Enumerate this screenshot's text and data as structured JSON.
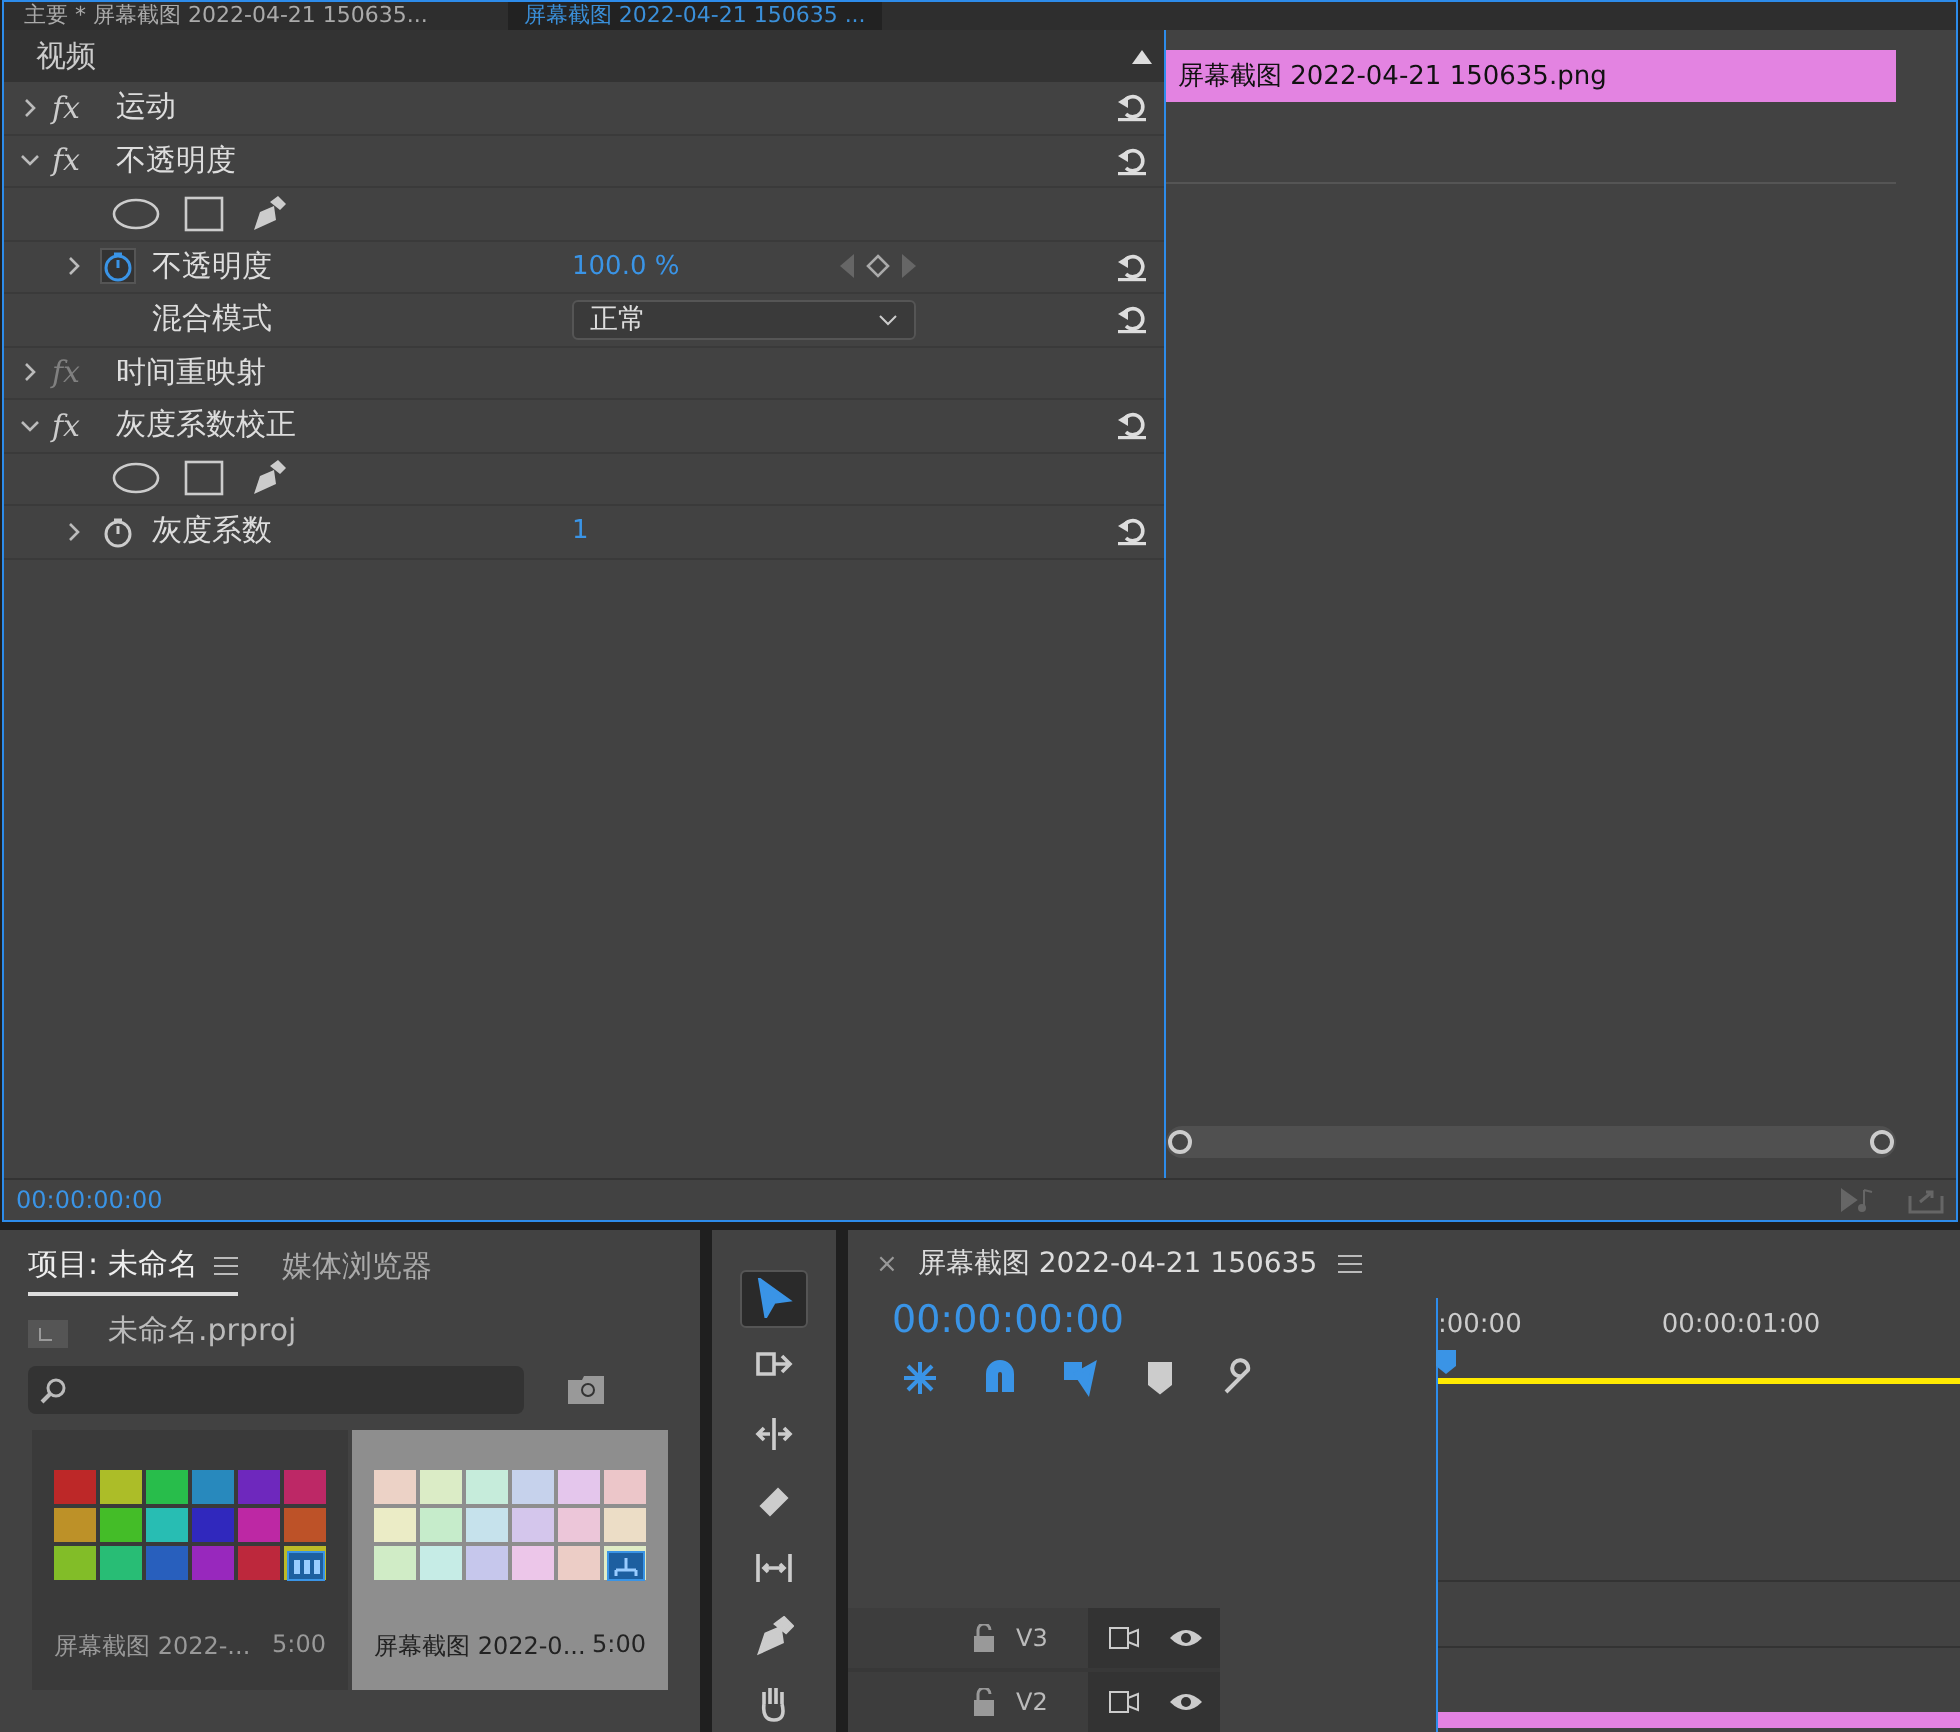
{
  "effect_controls": {
    "header": {
      "master": "主要 * 屏幕截图 2022-04-21 150635...",
      "clip": "屏幕截图 2022-04-21 150635 ..."
    },
    "section": "视频",
    "effects": [
      {
        "fx": "fx",
        "name": "运动",
        "expanded": false,
        "enabled": true,
        "resettable": true
      },
      {
        "fx": "fx",
        "name": "不透明度",
        "expanded": true,
        "enabled": true,
        "resettable": true,
        "params": [
          {
            "kind": "masks"
          },
          {
            "kind": "value",
            "name": "不透明度",
            "value": "100.0 %",
            "animated": true
          },
          {
            "kind": "dropdown",
            "name": "混合模式",
            "value": "正常"
          }
        ]
      },
      {
        "fx": "fx",
        "name": "时间重映射",
        "expanded": false,
        "enabled": false,
        "resettable": false
      },
      {
        "fx": "fx",
        "name": "灰度系数校正",
        "expanded": true,
        "enabled": true,
        "resettable": true,
        "params": [
          {
            "kind": "masks"
          },
          {
            "kind": "value",
            "name": "灰度系数",
            "value": "1",
            "animated": false
          }
        ]
      }
    ],
    "clip": {
      "label": "屏幕截图 2022-04-21  150635.png",
      "color": "#e383e1"
    },
    "timecode": "00:00:00:00"
  },
  "project": {
    "tabs": [
      {
        "label": "项目: 未命名",
        "selected": true
      },
      {
        "label": "媒体浏览器",
        "selected": false
      }
    ],
    "file": "未命名.prproj",
    "items": [
      {
        "kind": "clip",
        "name": "屏幕截图 2022-...",
        "duration": "5:00",
        "selected": false
      },
      {
        "kind": "sequence",
        "name": "屏幕截图 2022-0...",
        "duration": "5:00",
        "selected": true
      }
    ]
  },
  "tools": [
    {
      "selected": true
    },
    {
      "selected": false
    },
    {
      "selected": false
    },
    {
      "selected": false
    },
    {
      "selected": false
    },
    {
      "selected": false
    },
    {
      "selected": false
    }
  ],
  "timeline": {
    "close": "×",
    "title": "屏幕截图 2022-04-21 150635",
    "timecode": "00:00:00:00",
    "toggles": [
      {
        "on": true
      },
      {
        "on": true
      },
      {
        "on": true
      },
      {
        "on": false
      },
      {
        "on": false
      }
    ],
    "ruler": [
      ":00:00",
      "00:00:01:00"
    ],
    "tracks": [
      {
        "name": "V3"
      },
      {
        "name": "V2"
      }
    ]
  }
}
